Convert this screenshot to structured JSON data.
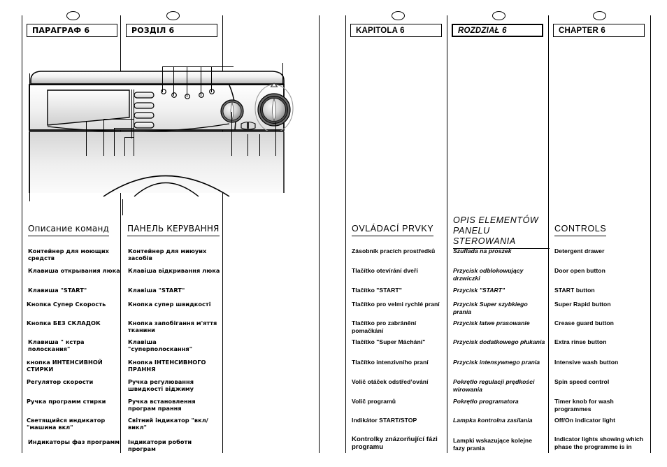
{
  "chapters": [
    {
      "id": "ru",
      "label": "ПАРАГРАФ 6"
    },
    {
      "id": "ua",
      "label": "РОЗДІЛ 6"
    },
    {
      "id": "cz",
      "label": "KAPITOLA 6"
    },
    {
      "id": "pl",
      "label": "ROZDZIAŁ 6"
    },
    {
      "id": "en",
      "label": "CHAPTER 6"
    }
  ],
  "sections": {
    "ru": {
      "heading": "Описание команд"
    },
    "ua": {
      "heading": "ПАНЕЛЬ КЕРУВАННЯ"
    },
    "cz": {
      "heading": "OVLÁDACÍ PRVKY"
    },
    "pl": {
      "heading": "OPIS ELEMENTÓW PANELU STEROWANIA"
    },
    "en": {
      "heading": "CONTROLS"
    }
  },
  "controls": {
    "ru": [
      "Контейнер для моющих средств",
      "Клавиша открывания люка",
      "Клавиша \"START\"",
      "Кнопка Супер Скорость",
      "Кнопка БЕЗ СКЛАДОК",
      "Клавиша \" кстра полоскания\"",
      "кнопка ИНТЕНСИВНОЙ СТИРКИ",
      "Регулятор скорости",
      "Ручка программ стирки",
      "Светящийся индикатор \"машина вкл\"",
      "Индикаторы фаз программ"
    ],
    "ua": [
      "Контейнер для миюуих засобів",
      "Клавіша відкривання люка",
      "Клавіша \"START\"",
      "Кнопка супер швидкості",
      "Кнопка запобігання м'яття тканини",
      "Клавіша \"суперполоскання\"",
      "Кнопка ІНТЕНСИВНОГО ПРАННЯ",
      "Ручка регулювання швидкості віджиму",
      "Ручка встановлення програм прання",
      "Світний індикатор \"вкл/викл\"",
      "Індикатори роботи програм"
    ],
    "cz": [
      "Zásobník pracích prostředků",
      "Tlačítko otevírání dveří",
      "Tlačítko \"START\"",
      "Tlačítko pro velmi rychlé praní",
      "Tlačítko pro zabránění pomačkání",
      "Tlačítko \"Super Máchání\"",
      "Tlačítko intenzivního praní",
      "Volič otáček odstřed’ování",
      "Volič programů",
      "Indikátor START/STOP",
      "Kontrolky znázorňující fázi programu"
    ],
    "pl": [
      "Szuflada na proszek",
      "Przycisk odblokowujący drzwiczki",
      "Przycisk \"START\"",
      "Przycisk Super szybkiego prania",
      "Przycisk łatwe prasowanie",
      "Przycisk dodatkowego płukania",
      "Przycisk intensywnego prania",
      "Pokrętło regulacji prędkości wirowania",
      "Pokrętło programatora",
      "Lampka kontrolna zasilania",
      "Lampki wskazujące kolejne fazy prania"
    ],
    "en": [
      "Detergent drawer",
      "Door open button",
      "START button",
      "Super Rapid button",
      "Crease guard button",
      "Extra rinse button",
      "Intensive wash button",
      "Spin speed control",
      "Timer knob for wash programmes",
      "Off/On indicator light",
      "Indicator lights showing which phase the programme is in"
    ]
  },
  "illustration": {
    "name": "washing-machine-control-panel-diagram",
    "indicator_count": 5,
    "button_count": 4,
    "knob_count": 2,
    "colors": {
      "outline": "#000000",
      "panel_light": "#f2f2f2",
      "panel_shade": "#c9c9c9",
      "knob_dark": "#3a3a3a"
    }
  }
}
